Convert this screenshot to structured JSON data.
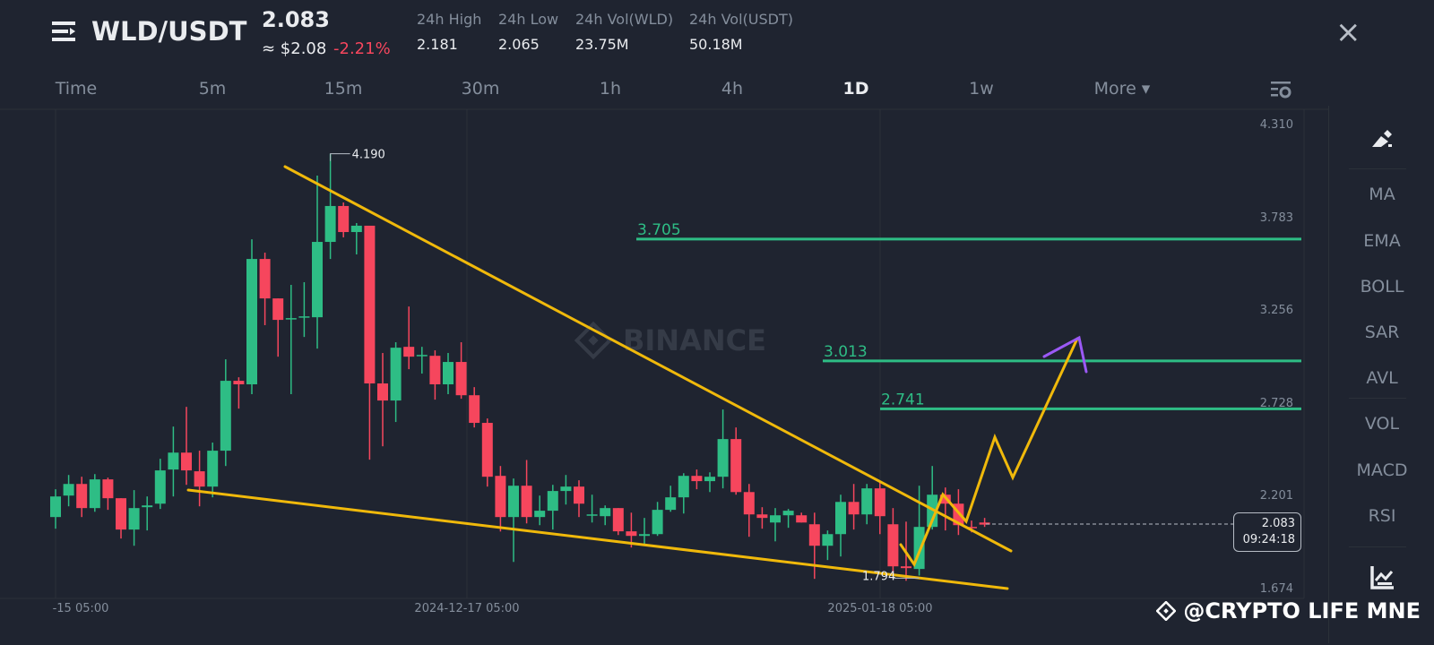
{
  "header": {
    "symbol": "WLD/USDT",
    "last_price": "2.083",
    "usd_price": "≈ $2.08",
    "change": "-2.21%",
    "stats": [
      {
        "label": "24h High",
        "value": "2.181"
      },
      {
        "label": "24h Low",
        "value": "2.065"
      },
      {
        "label": "24h Vol(WLD)",
        "value": "23.75M"
      },
      {
        "label": "24h Vol(USDT)",
        "value": "50.18M"
      }
    ],
    "close_icon": "×"
  },
  "tabs": [
    {
      "label": "Time"
    },
    {
      "label": "5m"
    },
    {
      "label": "15m"
    },
    {
      "label": "30m"
    },
    {
      "label": "1h"
    },
    {
      "label": "4h"
    },
    {
      "label": "1D",
      "active": true
    },
    {
      "label": "1w"
    },
    {
      "label": "More ▾"
    }
  ],
  "sidebar": {
    "items": [
      "MA",
      "EMA",
      "BOLL",
      "SAR",
      "AVL",
      "VOL",
      "MACD",
      "RSI"
    ]
  },
  "watermark": "BINANCE",
  "credit": "@CRYPTO LIFE MNE",
  "colors": {
    "up": "#2ebd85",
    "down": "#f6465d",
    "trend": "#f0b90b",
    "level": "#2ebd85",
    "projection": "#9b59f6"
  },
  "chart_data": {
    "type": "candlestick",
    "y_ticks": [
      "4.310",
      "3.783",
      "3.256",
      "2.728",
      "2.201",
      "1.674"
    ],
    "ylim": [
      1.674,
      4.31
    ],
    "x_ticks": [
      "-15 05:00",
      "2024-12-17 05:00",
      "2025-01-18 05:00"
    ],
    "high_label": "4.190",
    "low_label": "1.794",
    "current_price": "2.083",
    "countdown": "09:24:18",
    "levels": [
      {
        "price": 3.705,
        "label": "3.705"
      },
      {
        "price": 3.013,
        "label": "3.013"
      },
      {
        "price": 2.741,
        "label": "2.741"
      }
    ],
    "candles_ohlc": [
      [
        2.126,
        2.284,
        2.06,
        2.243
      ],
      [
        2.248,
        2.365,
        2.187,
        2.314
      ],
      [
        2.314,
        2.355,
        2.126,
        2.177
      ],
      [
        2.177,
        2.37,
        2.156,
        2.34
      ],
      [
        2.34,
        2.35,
        2.167,
        2.233
      ],
      [
        2.233,
        2.233,
        2.004,
        2.055
      ],
      [
        2.055,
        2.279,
        1.963,
        2.177
      ],
      [
        2.182,
        2.243,
        2.05,
        2.192
      ],
      [
        2.202,
        2.457,
        2.172,
        2.391
      ],
      [
        2.396,
        2.64,
        2.243,
        2.492
      ],
      [
        2.492,
        2.752,
        2.309,
        2.391
      ],
      [
        2.386,
        2.503,
        2.187,
        2.299
      ],
      [
        2.299,
        2.549,
        2.238,
        2.503
      ],
      [
        2.503,
        3.022,
        2.416,
        2.9
      ],
      [
        2.9,
        2.92,
        2.742,
        2.88
      ],
      [
        2.88,
        3.704,
        2.824,
        3.592
      ],
      [
        3.592,
        3.628,
        3.216,
        3.368
      ],
      [
        3.368,
        3.368,
        3.037,
        3.246
      ],
      [
        3.251,
        3.445,
        2.824,
        3.256
      ],
      [
        3.261,
        3.46,
        3.149,
        3.266
      ],
      [
        3.261,
        4.066,
        3.083,
        3.689
      ],
      [
        3.689,
        4.19,
        3.592,
        3.893
      ],
      [
        3.893,
        3.913,
        3.715,
        3.745
      ],
      [
        3.745,
        3.796,
        3.618,
        3.781
      ],
      [
        3.781,
        3.781,
        2.452,
        2.885
      ],
      [
        2.885,
        3.058,
        2.528,
        2.788
      ],
      [
        2.788,
        3.119,
        2.666,
        3.088
      ],
      [
        3.093,
        3.322,
        2.966,
        3.037
      ],
      [
        3.042,
        3.093,
        2.941,
        3.047
      ],
      [
        3.042,
        3.073,
        2.793,
        2.88
      ],
      [
        2.88,
        3.058,
        2.824,
        3.007
      ],
      [
        3.007,
        3.119,
        2.798,
        2.818
      ],
      [
        2.818,
        2.864,
        2.635,
        2.661
      ],
      [
        2.661,
        2.686,
        2.299,
        2.355
      ],
      [
        2.36,
        2.416,
        2.044,
        2.126
      ],
      [
        2.126,
        2.345,
        1.871,
        2.304
      ],
      [
        2.304,
        2.45,
        2.09,
        2.126
      ],
      [
        2.126,
        2.248,
        2.08,
        2.162
      ],
      [
        2.162,
        2.309,
        2.055,
        2.274
      ],
      [
        2.274,
        2.365,
        2.197,
        2.299
      ],
      [
        2.299,
        2.335,
        2.126,
        2.202
      ],
      [
        2.136,
        2.253,
        2.095,
        2.141
      ],
      [
        2.131,
        2.192,
        2.08,
        2.177
      ],
      [
        2.177,
        2.177,
        2.024,
        2.045
      ],
      [
        2.045,
        2.151,
        1.953,
        2.019
      ],
      [
        2.019,
        2.121,
        1.963,
        2.029
      ],
      [
        2.029,
        2.212,
        2.019,
        2.167
      ],
      [
        2.167,
        2.304,
        2.156,
        2.238
      ],
      [
        2.238,
        2.375,
        2.146,
        2.36
      ],
      [
        2.36,
        2.396,
        2.284,
        2.33
      ],
      [
        2.33,
        2.38,
        2.268,
        2.355
      ],
      [
        2.355,
        2.737,
        2.289,
        2.569
      ],
      [
        2.569,
        2.635,
        2.253,
        2.268
      ],
      [
        2.268,
        2.314,
        2.014,
        2.141
      ],
      [
        2.141,
        2.182,
        2.06,
        2.121
      ],
      [
        2.095,
        2.177,
        1.988,
        2.136
      ],
      [
        2.136,
        2.172,
        2.065,
        2.162
      ],
      [
        2.136,
        2.151,
        2.095,
        2.095
      ],
      [
        2.085,
        2.151,
        1.775,
        1.963
      ],
      [
        1.963,
        2.05,
        1.882,
        2.029
      ],
      [
        2.029,
        2.253,
        1.902,
        2.212
      ],
      [
        2.212,
        2.314,
        2.055,
        2.141
      ],
      [
        2.141,
        2.314,
        2.085,
        2.289
      ],
      [
        2.289,
        2.324,
        2.029,
        2.131
      ],
      [
        2.085,
        2.177,
        1.79,
        1.846
      ],
      [
        1.846,
        2.1,
        1.764,
        1.836
      ],
      [
        1.831,
        2.304,
        1.794,
        2.07
      ],
      [
        2.07,
        2.416,
        2.055,
        2.253
      ],
      [
        2.253,
        2.294,
        2.05,
        2.202
      ],
      [
        2.202,
        2.284,
        2.024,
        2.08
      ],
      [
        2.07,
        2.106,
        2.039,
        2.065
      ],
      [
        2.095,
        2.121,
        2.07,
        2.083
      ]
    ]
  }
}
